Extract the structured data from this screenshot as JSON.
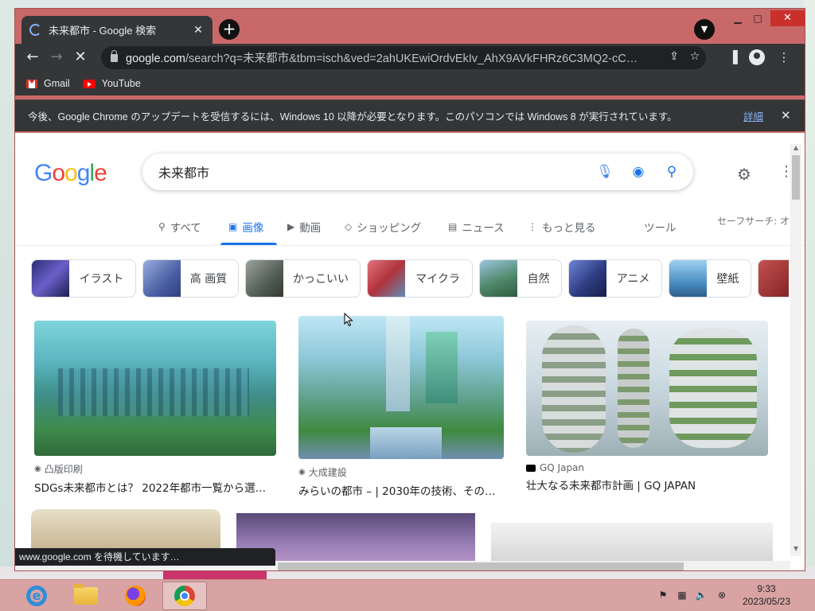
{
  "browser": {
    "tab_title": "未来都市 - Google 検索",
    "url_host": "google.com",
    "url_rest": "/search?q=未来都市&tbm=isch&ved=2ahUKEwiOrdvEkIv_AhX9AVkFHRz6C3MQ2-cC…",
    "bookmarks": [
      {
        "label": "Gmail",
        "icon": "gmail-icon"
      },
      {
        "label": "YouTube",
        "icon": "youtube-icon"
      }
    ],
    "infobar_text": "今後、Google Chrome のアップデートを受信するには、Windows 10 以降が必要となります。このパソコンでは Windows 8 が実行されています。",
    "infobar_link": "詳細",
    "status_text": "www.google.com を待機しています…"
  },
  "google": {
    "query": "未来都市",
    "nav": [
      {
        "label": "すべて",
        "icon": "search-icon"
      },
      {
        "label": "画像",
        "icon": "image-icon",
        "active": true
      },
      {
        "label": "動画",
        "icon": "video-icon"
      },
      {
        "label": "ショッピング",
        "icon": "tag-icon"
      },
      {
        "label": "ニュース",
        "icon": "news-icon"
      },
      {
        "label": "もっと見る",
        "icon": "more-icon"
      },
      {
        "label": "ツール",
        "icon": ""
      }
    ],
    "safesearch": "セーフサーチ: オ",
    "chips": [
      {
        "label": "イラスト",
        "color": "#3a3f8f"
      },
      {
        "label": "高 画質",
        "color": "#5b6fb0"
      },
      {
        "label": "かっこいい",
        "color": "#6f7a72"
      },
      {
        "label": "マイクラ",
        "color": "#c04a54"
      },
      {
        "label": "自然",
        "color": "#4f8a6a"
      },
      {
        "label": "アニメ",
        "color": "#3d4c8c"
      },
      {
        "label": "壁紙",
        "color": "#4d8fc4"
      },
      {
        "label": "",
        "color": "#8c2d2d"
      }
    ],
    "results": [
      {
        "source": "凸版印刷",
        "title": "SDGs未来都市とは？ 2022年都市一覧から選…",
        "source_icon": "globe-icon"
      },
      {
        "source": "大成建設",
        "title": "みらいの都市 – | 2030年の技術、その…",
        "source_icon": "globe-icon"
      },
      {
        "source": "GQ Japan",
        "title": "壮大なる未来都市計画 | GQ JAPAN",
        "source_icon": "gq-icon"
      }
    ]
  },
  "taskbar": {
    "time": "9:33",
    "date": "2023/05/23"
  }
}
